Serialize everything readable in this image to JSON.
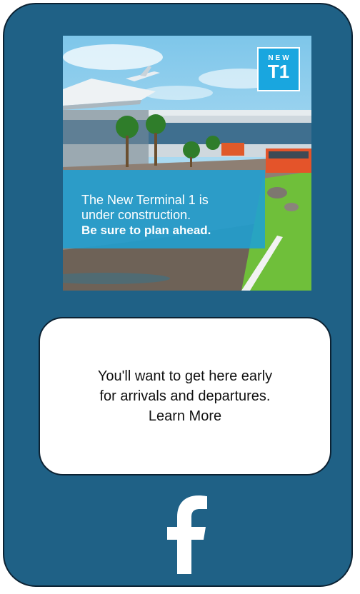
{
  "promo": {
    "badge_top": "NEW",
    "badge_main": "T1",
    "headline_line1": "The New Terminal 1 is",
    "headline_line2": "under construction.",
    "headline_bold": "Be sure to plan ahead."
  },
  "message": {
    "line1": "You'll want to get here early",
    "line2": "for arrivals and departures.",
    "link_label": "Learn More"
  },
  "icons": {
    "social": "facebook-icon"
  },
  "colors": {
    "card_background": "#1f6186",
    "card_border": "#0c2233",
    "promo_accent": "#19a6df",
    "text_dark": "#111111"
  }
}
